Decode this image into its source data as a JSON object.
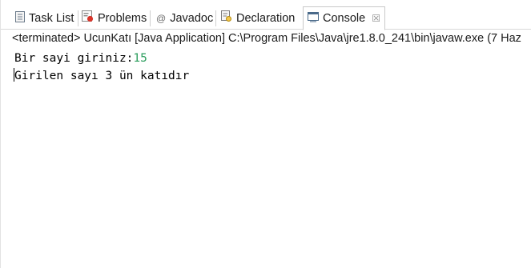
{
  "tabs": [
    {
      "label": "Task List",
      "icon": "task-list-icon"
    },
    {
      "label": "Problems",
      "icon": "problems-icon"
    },
    {
      "label": "Javadoc",
      "icon": "at-sign-icon"
    },
    {
      "label": "Declaration",
      "icon": "declaration-icon"
    },
    {
      "label": "Console",
      "icon": "console-icon",
      "active": true,
      "close": "☒"
    }
  ],
  "status": {
    "text": "<terminated> UcunKatı [Java Application] C:\\Program Files\\Java\\jre1.8.0_241\\bin\\javaw.exe (7 Haz"
  },
  "console": {
    "prompt": "Bir sayi giriniz:",
    "input": "15",
    "output": "Girilen sayı 3 ün katıdır"
  },
  "colors": {
    "input_text": "#2a9d5c"
  }
}
